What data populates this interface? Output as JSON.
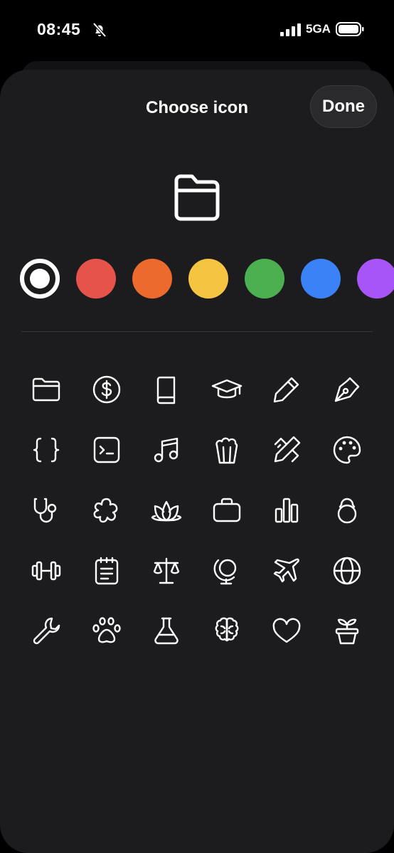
{
  "status_bar": {
    "time": "08:45",
    "network": "5GA"
  },
  "sheet": {
    "title": "Choose icon",
    "done_label": "Done"
  },
  "selected_icon": "folder-icon",
  "colors": [
    {
      "name": "white",
      "hex": "#ffffff",
      "selected": true
    },
    {
      "name": "red",
      "hex": "#e5534b"
    },
    {
      "name": "orange",
      "hex": "#ec6a2c"
    },
    {
      "name": "yellow",
      "hex": "#f5c542"
    },
    {
      "name": "green",
      "hex": "#4caf50"
    },
    {
      "name": "blue",
      "hex": "#3b82f6"
    },
    {
      "name": "purple",
      "hex": "#a855f7"
    }
  ],
  "icons": [
    "folder-icon",
    "dollar-circle-icon",
    "book-icon",
    "graduation-cap-icon",
    "pencil-icon",
    "pen-nib-icon",
    "code-braces-icon",
    "terminal-icon",
    "music-note-icon",
    "popcorn-icon",
    "pencil-ruler-icon",
    "palette-icon",
    "stethoscope-icon",
    "flower-icon",
    "lotus-icon",
    "briefcase-icon",
    "bar-chart-icon",
    "kettlebell-icon",
    "dumbbell-icon",
    "notepad-icon",
    "scale-icon",
    "globe-stand-icon",
    "airplane-icon",
    "globe-icon",
    "wrench-icon",
    "paw-icon",
    "flask-icon",
    "brain-icon",
    "heart-icon",
    "plant-pot-icon"
  ]
}
